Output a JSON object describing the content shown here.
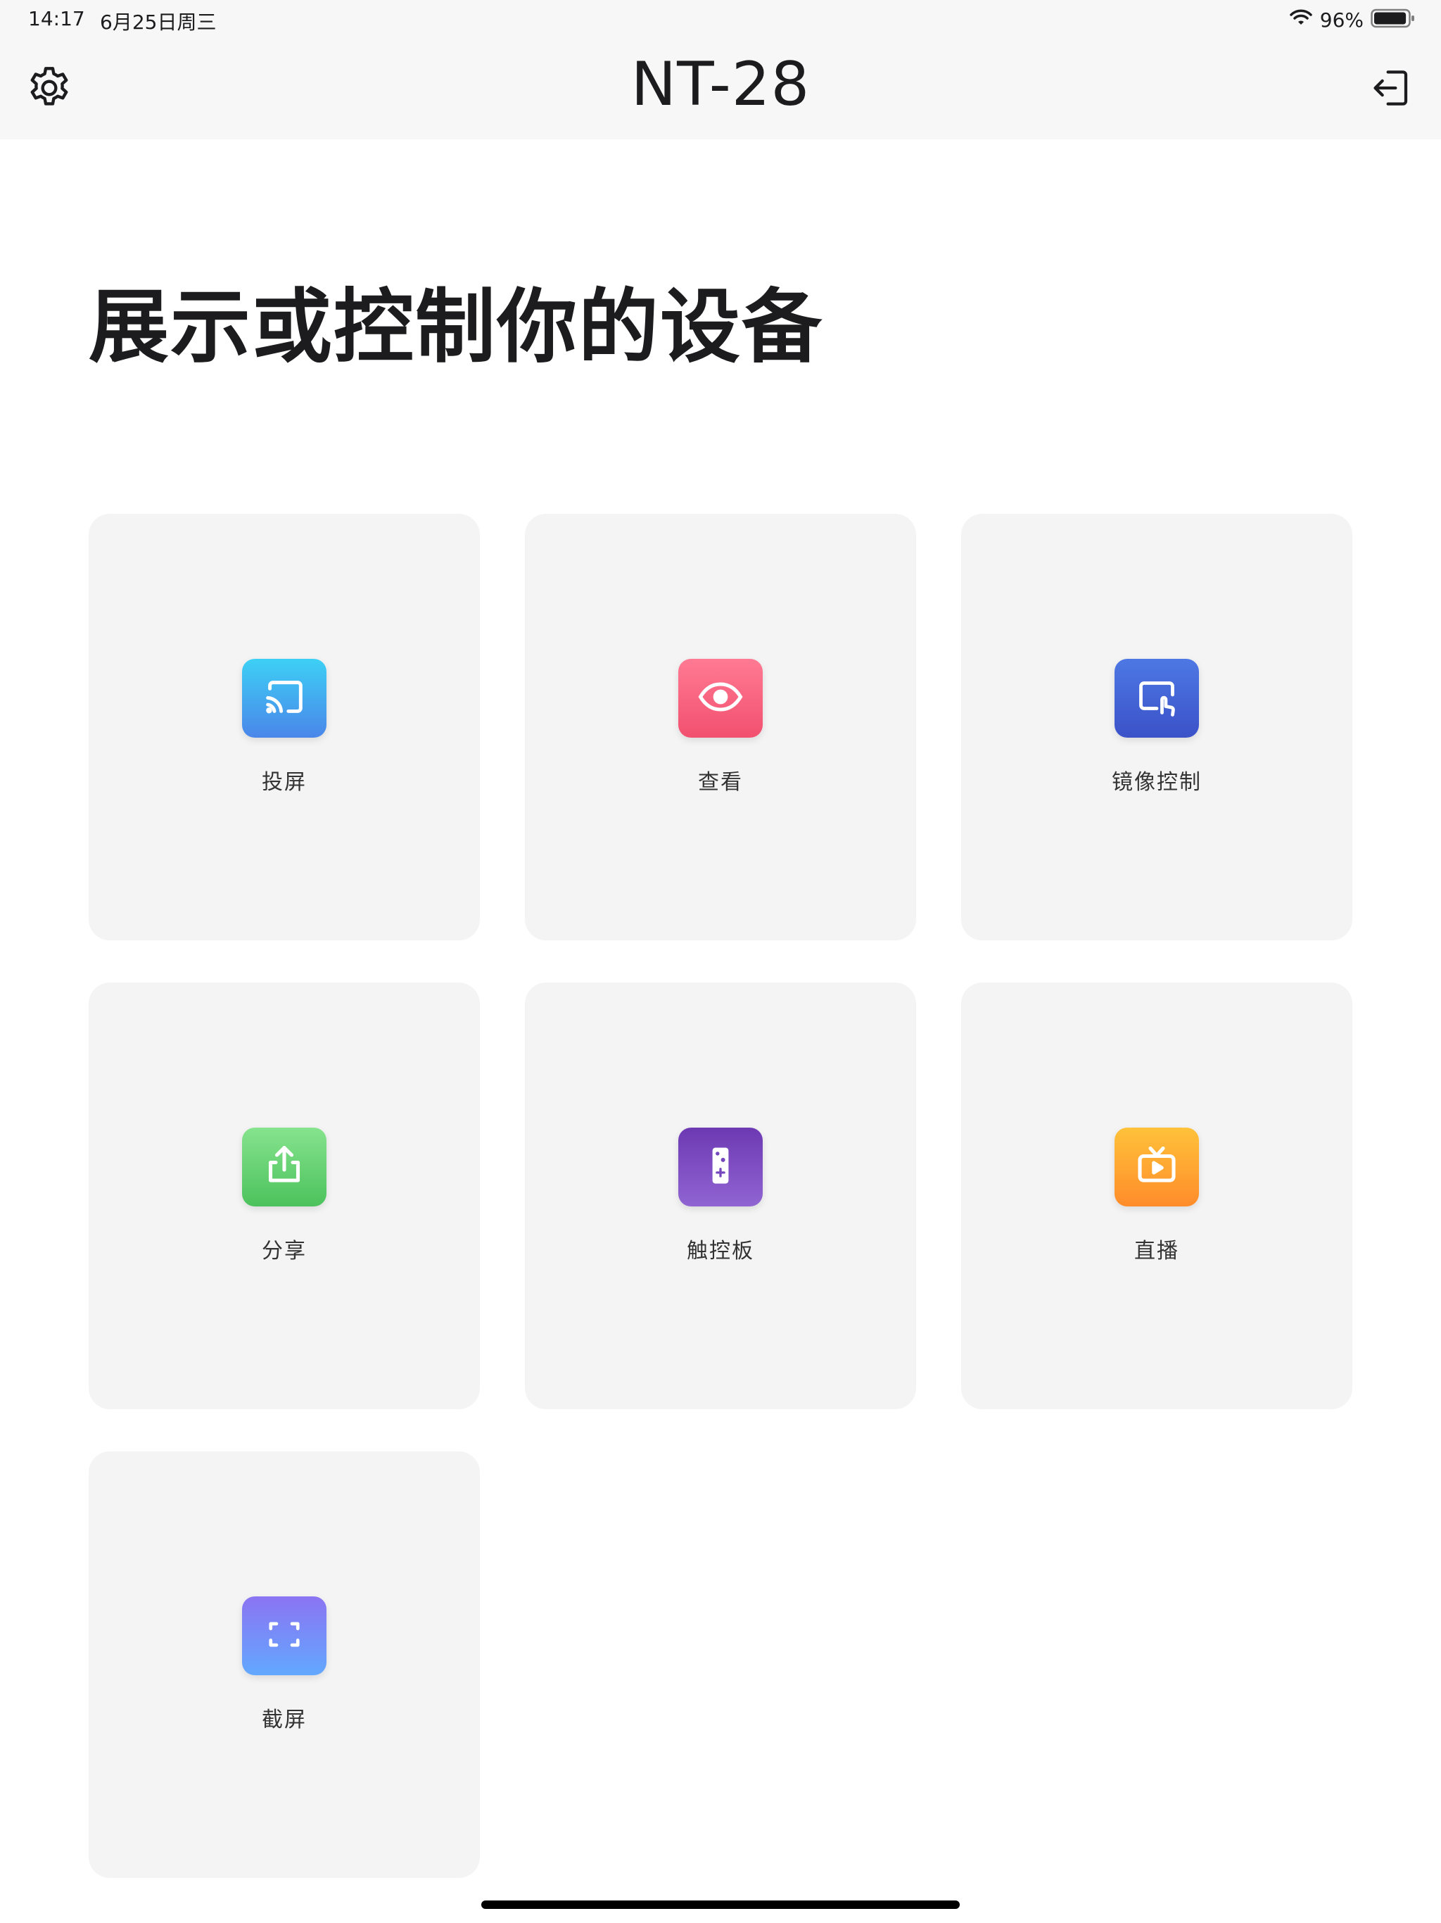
{
  "status": {
    "time": "14:17",
    "date": "6月25日周三",
    "battery": "96%",
    "battery_level": 0.96
  },
  "nav": {
    "title": "NT-28",
    "left_icon": "gear-icon",
    "right_icon": "logout-icon"
  },
  "page": {
    "title": "展示或控制你的设备"
  },
  "cards": [
    {
      "label": "投屏",
      "icon": "cast-icon",
      "gradient": [
        "#3dd0f5",
        "#4a86ea"
      ]
    },
    {
      "label": "查看",
      "icon": "eye-icon",
      "gradient": [
        "#ff7a93",
        "#f2506f"
      ]
    },
    {
      "label": "镜像控制",
      "icon": "screen-touch-icon",
      "gradient": [
        "#4d78e4",
        "#3b52c8"
      ]
    },
    {
      "label": "分享",
      "icon": "share-upload-icon",
      "gradient": [
        "#86e38e",
        "#4cc25c"
      ]
    },
    {
      "label": "触控板",
      "icon": "remote-control-icon",
      "gradient": [
        "#6d39b3",
        "#9064d2"
      ]
    },
    {
      "label": "直播",
      "icon": "tv-play-icon",
      "gradient": [
        "#ffc23a",
        "#ff8c2a"
      ]
    },
    {
      "label": "截屏",
      "icon": "screenshot-frame-icon",
      "gradient": [
        "#8b74f2",
        "#62a8ff"
      ]
    }
  ]
}
